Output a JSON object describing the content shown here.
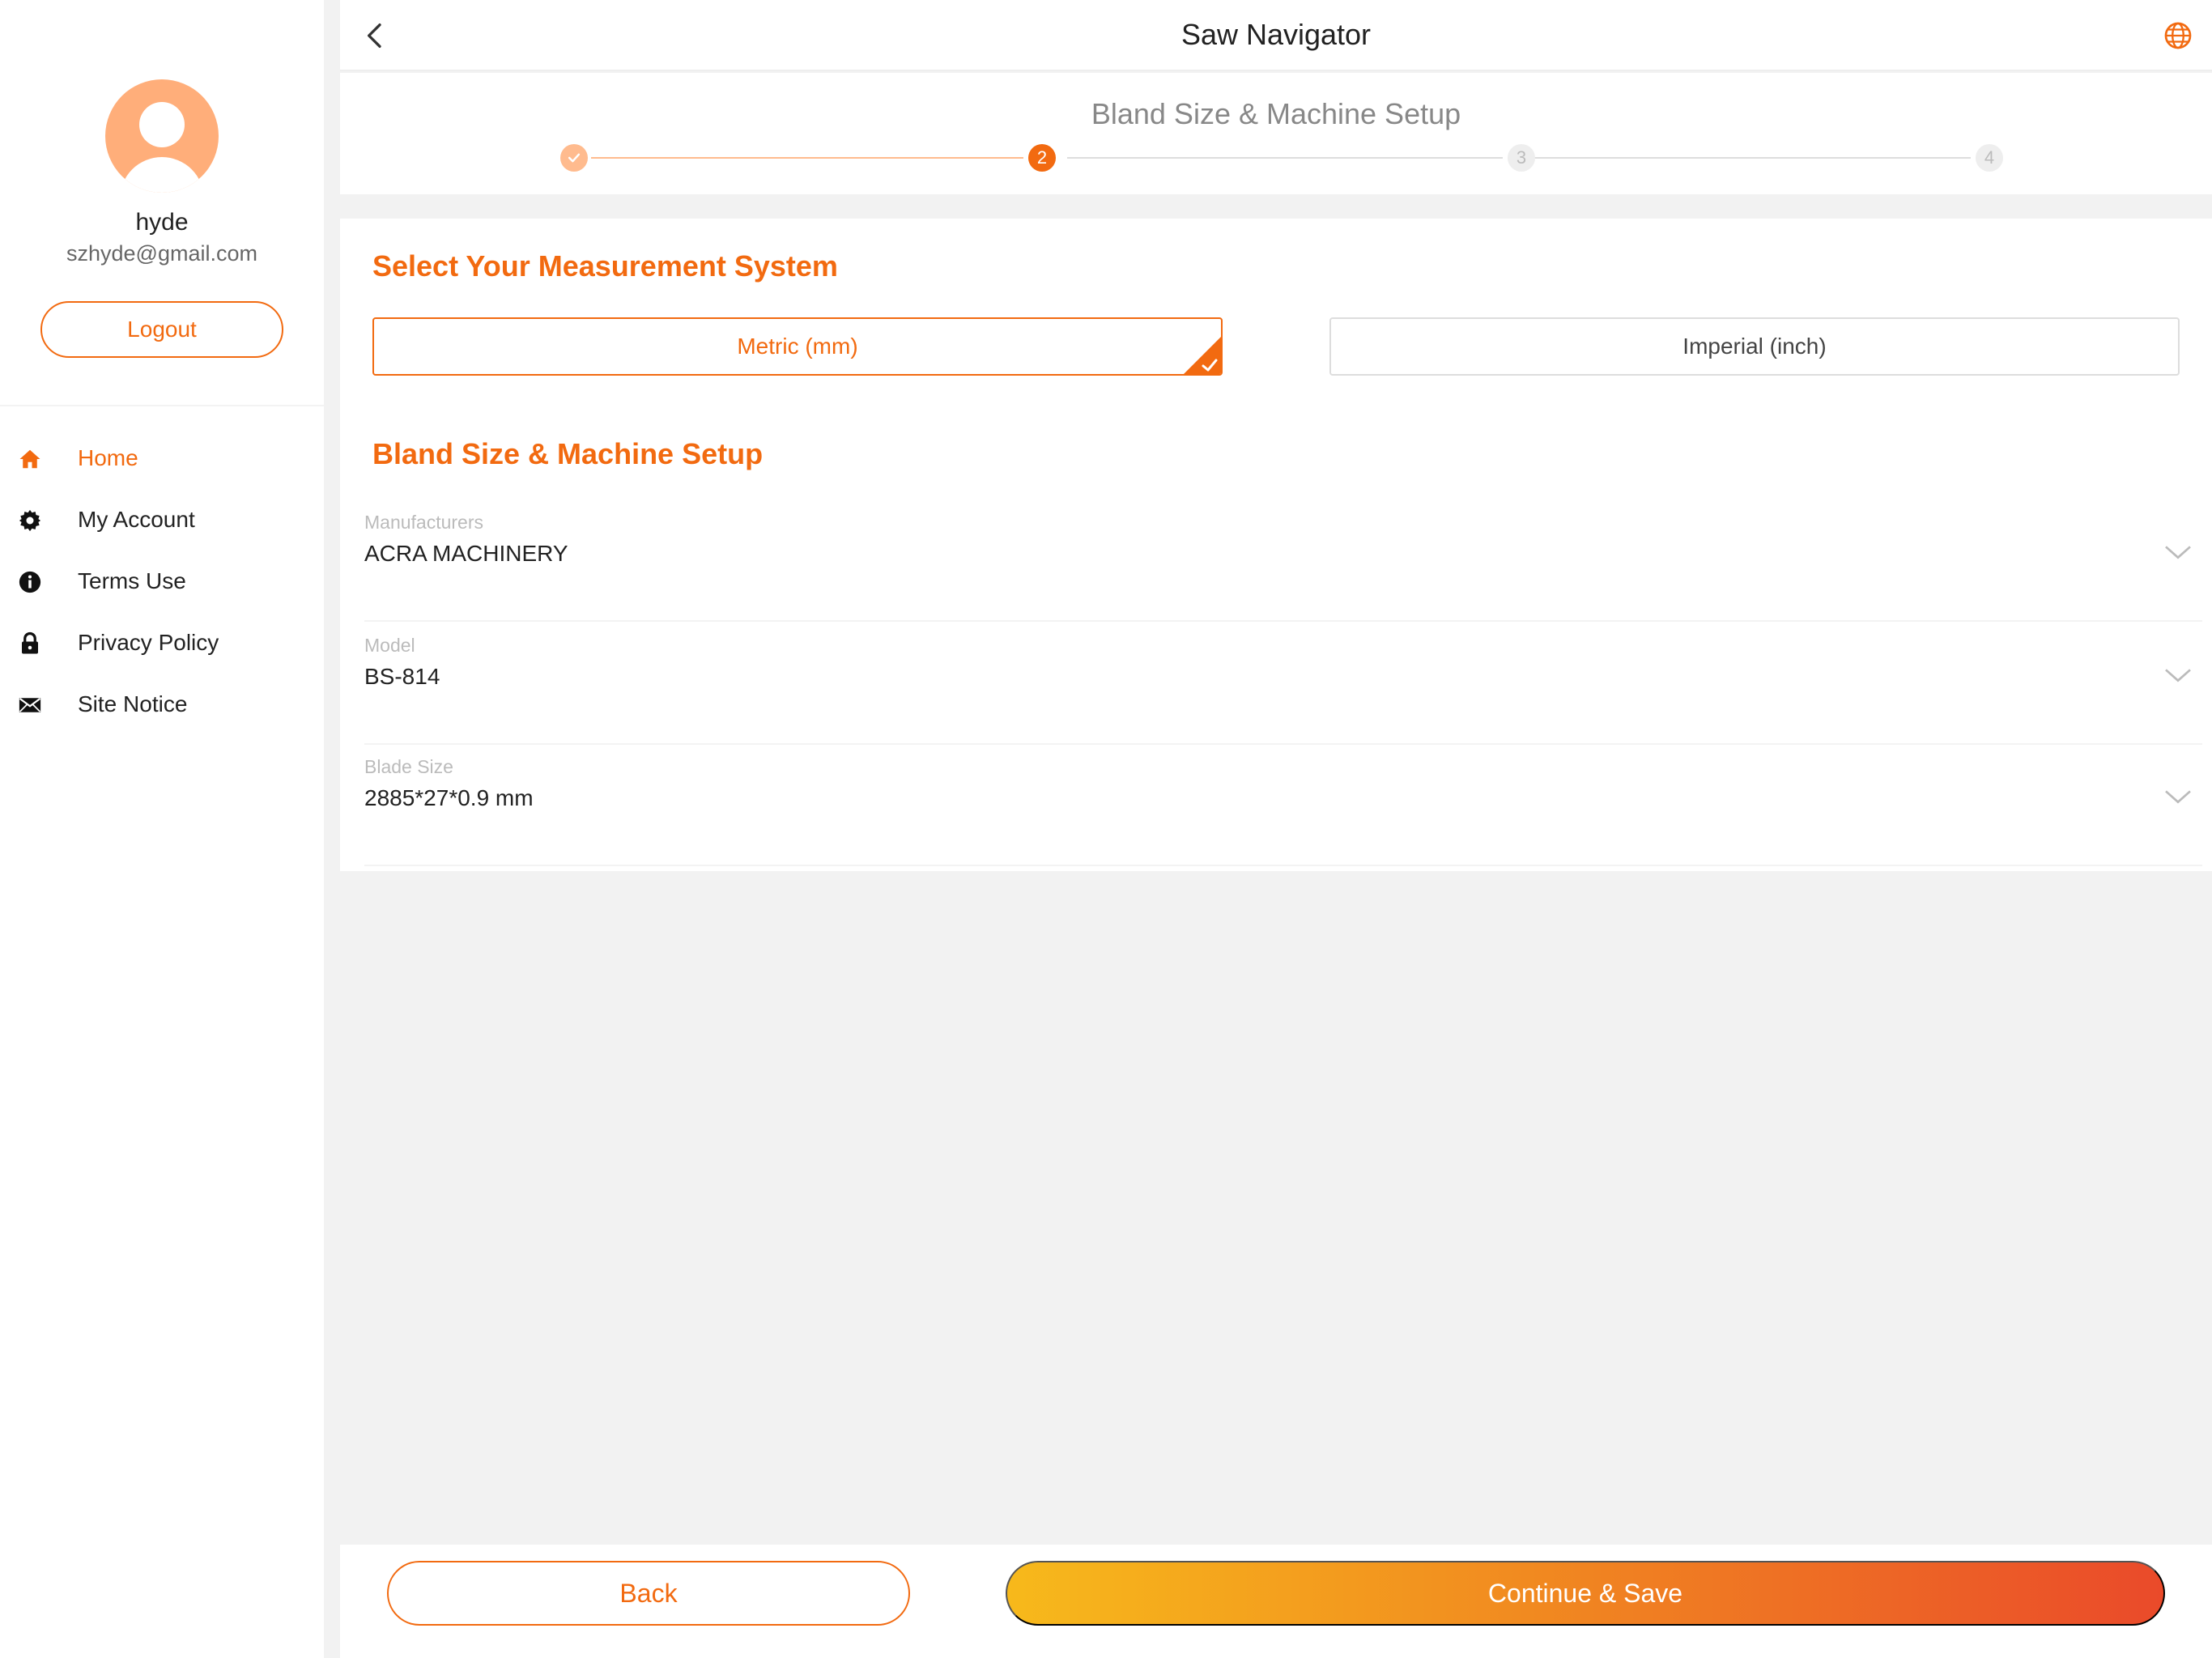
{
  "app": {
    "title": "Saw Navigator"
  },
  "user": {
    "name": "hyde",
    "email": "szhyde@gmail.com",
    "logout_label": "Logout"
  },
  "sidebar": {
    "items": [
      {
        "label": "Home",
        "icon": "home-icon",
        "active": true
      },
      {
        "label": "My Account",
        "icon": "gear-icon"
      },
      {
        "label": "Terms Use",
        "icon": "info-icon"
      },
      {
        "label": "Privacy Policy",
        "icon": "lock-icon"
      },
      {
        "label": "Site Notice",
        "icon": "envelope-icon"
      }
    ]
  },
  "stepper": {
    "title": "Bland Size & Machine Setup",
    "steps": [
      {
        "label": "",
        "state": "done"
      },
      {
        "label": "2",
        "state": "current"
      },
      {
        "label": "3",
        "state": "todo"
      },
      {
        "label": "4",
        "state": "todo"
      }
    ]
  },
  "measurement": {
    "title": "Select Your Measurement System",
    "options": [
      {
        "label": "Metric (mm)",
        "selected": true
      },
      {
        "label": "Imperial (inch)",
        "selected": false
      }
    ]
  },
  "setup": {
    "title": "Bland Size & Machine Setup",
    "fields": [
      {
        "label": "Manufacturers",
        "value": "ACRA MACHINERY"
      },
      {
        "label": "Model",
        "value": "BS-814"
      },
      {
        "label": "Blade Size",
        "value": "2885*27*0.9 mm"
      }
    ]
  },
  "footer": {
    "back_label": "Back",
    "continue_label": "Continue & Save"
  },
  "colors": {
    "accent": "#f26a10",
    "gradient_start": "#f7b91b",
    "gradient_end": "#ea4a2a"
  }
}
